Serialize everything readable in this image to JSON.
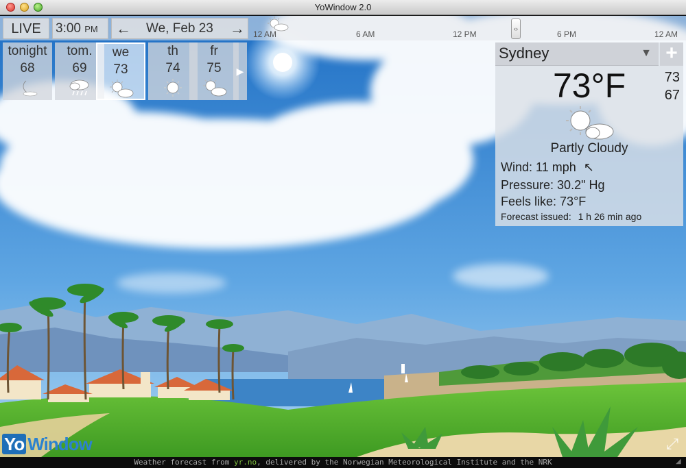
{
  "window": {
    "title": "YoWindow 2.0"
  },
  "controls": {
    "live_label": "LIVE",
    "time": "3:00",
    "time_ampm": "PM",
    "date": "We, Feb 23",
    "prev_arrow": "←",
    "next_arrow": "→"
  },
  "timeline": {
    "ticks": [
      "12 AM",
      "6 AM",
      "12 PM",
      "6 PM",
      "12 AM"
    ],
    "handle_glyph": "‹›"
  },
  "forecast": {
    "days": [
      {
        "name": "tonight",
        "temp": "68",
        "icon": "moon-icon"
      },
      {
        "name": "tom.",
        "temp": "69",
        "icon": "rain-icon"
      },
      {
        "name": "we",
        "temp": "73",
        "icon": "partly-cloudy-icon"
      },
      {
        "name": "th",
        "temp": "74",
        "icon": "sun-icon"
      },
      {
        "name": "fr",
        "temp": "75",
        "icon": "partly-cloudy-icon"
      }
    ],
    "next_glyph": "▶"
  },
  "current": {
    "city": "Sydney",
    "dropdown_glyph": "▼",
    "add_glyph": "+",
    "temperature": "73°F",
    "high": "73",
    "low": "67",
    "condition": "Partly Cloudy",
    "wind_label": "Wind:",
    "wind_value": "11 mph",
    "wind_arrow": "↖",
    "pressure_label": "Pressure:",
    "pressure_value": "30.2\" Hg",
    "feels_label": "Feels like:",
    "feels_value": "73°F",
    "issued_label": "Forecast issued:",
    "issued_value": "1 h 26 min ago"
  },
  "footer": {
    "prefix": "Weather forecast from ",
    "link": "yr.no",
    "suffix": ", delivered by the Norwegian Meteorological Institute and the NRK"
  },
  "logo": {
    "part1": "Yo",
    "part2": "Window"
  },
  "fullscreen_glyph": "⤢",
  "resize_glyph": "◢",
  "colors": {
    "sky_top": "#2b78c9",
    "sky_bottom": "#8ec4ee",
    "grass": "#4ea82a",
    "accent": "#1f6fb8"
  }
}
